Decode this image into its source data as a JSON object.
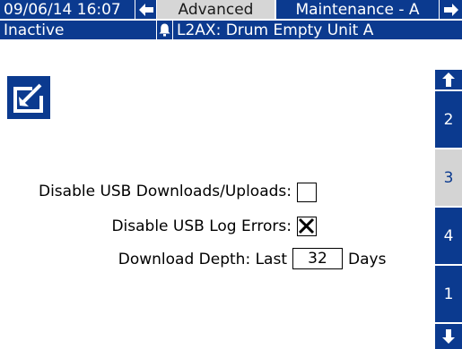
{
  "header": {
    "datetime": "09/06/14 16:07",
    "tab_active": "Advanced",
    "tab_next": "Maintenance - A"
  },
  "status": {
    "state": "Inactive",
    "alarm_text": "L2AX: Drum Empty Unit A"
  },
  "icons": {
    "back": "left-arrow-icon",
    "forward": "right-arrow-icon",
    "alarm": "bell-icon",
    "edit": "edit-icon",
    "page_up": "up-arrow-icon",
    "page_down": "down-arrow-icon"
  },
  "page_tabs": [
    "2",
    "3",
    "4",
    "1"
  ],
  "page_tabs_active": "3",
  "settings": {
    "disable_usb_label": "Disable USB Downloads/Uploads:",
    "disable_usb_checked": false,
    "disable_log_errors_label": "Disable USB Log Errors:",
    "disable_log_errors_checked": true,
    "download_depth_label": "Download Depth: Last",
    "download_depth_value": "32",
    "download_depth_unit": "Days"
  },
  "colors": {
    "header_blue": "#0b3a8f",
    "active_gray": "#d6d6d6",
    "background": "#ffffff"
  }
}
